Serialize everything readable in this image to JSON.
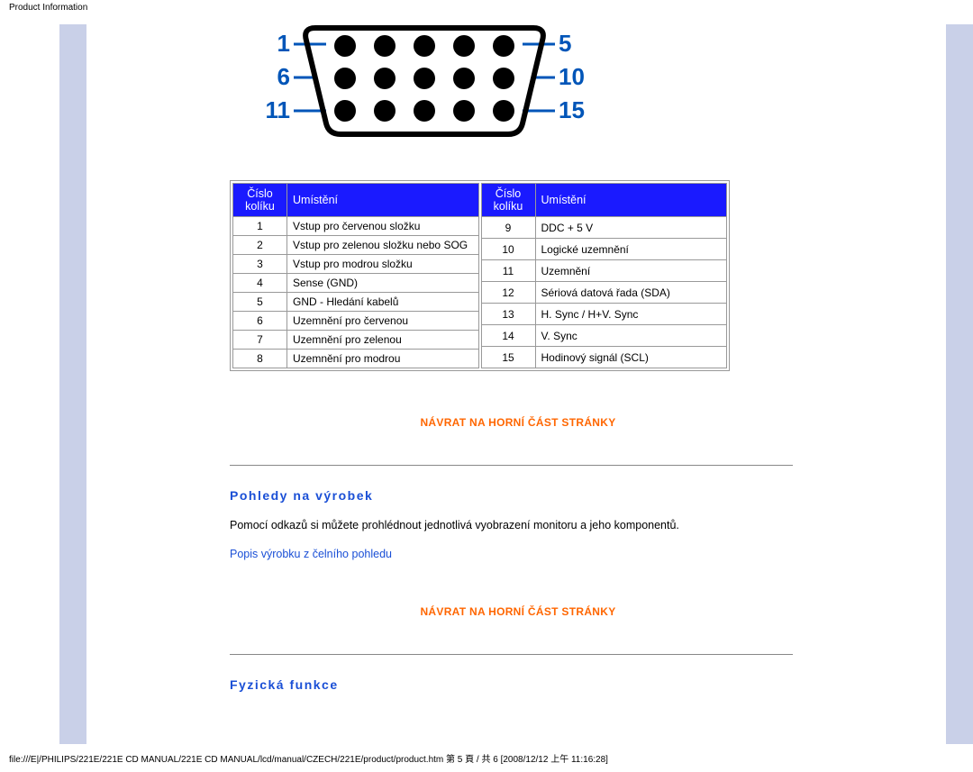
{
  "header": "Product Information",
  "connector": {
    "labels": {
      "tl": "1",
      "tr": "5",
      "ml": "6",
      "mr": "10",
      "bl": "11",
      "br": "15"
    }
  },
  "pin_table": {
    "left": {
      "head_num": "Číslo kolíku",
      "head_loc": "Umístění",
      "rows": [
        {
          "n": "1",
          "d": "Vstup pro červenou složku"
        },
        {
          "n": "2",
          "d": "Vstup pro zelenou složku nebo SOG"
        },
        {
          "n": "3",
          "d": "Vstup pro modrou složku"
        },
        {
          "n": "4",
          "d": "Sense (GND)"
        },
        {
          "n": "5",
          "d": "GND - Hledání kabelů"
        },
        {
          "n": "6",
          "d": "Uzemnění pro červenou"
        },
        {
          "n": "7",
          "d": "Uzemnění pro zelenou"
        },
        {
          "n": "8",
          "d": "Uzemnění pro modrou"
        }
      ]
    },
    "right": {
      "head_num": "Číslo kolíku",
      "head_loc": "Umístění",
      "rows": [
        {
          "n": "9",
          "d": "DDC + 5 V"
        },
        {
          "n": "10",
          "d": "Logické uzemnění"
        },
        {
          "n": "11",
          "d": "Uzemnění"
        },
        {
          "n": "12",
          "d": "Sériová datová řada (SDA)"
        },
        {
          "n": "13",
          "d": "H. Sync / H+V. Sync"
        },
        {
          "n": "14",
          "d": "V. Sync"
        },
        {
          "n": "15",
          "d": "Hodinový signál (SCL)"
        }
      ]
    }
  },
  "back_to_top": "NÁVRAT NA HORNÍ ČÁST STRÁNKY",
  "section1": {
    "heading": "Pohledy na výrobek",
    "body": "Pomocí odkazů si můžete prohlédnout jednotlivá vyobrazení monitoru a jeho komponentů.",
    "link": "Popis výrobku z čelního pohledu"
  },
  "section2": {
    "heading": "Fyzická funkce"
  },
  "footer": "file:///E|/PHILIPS/221E/221E CD MANUAL/221E CD MANUAL/lcd/manual/CZECH/221E/product/product.htm 第 5 頁 / 共 6  [2008/12/12 上午 11:16:28]"
}
